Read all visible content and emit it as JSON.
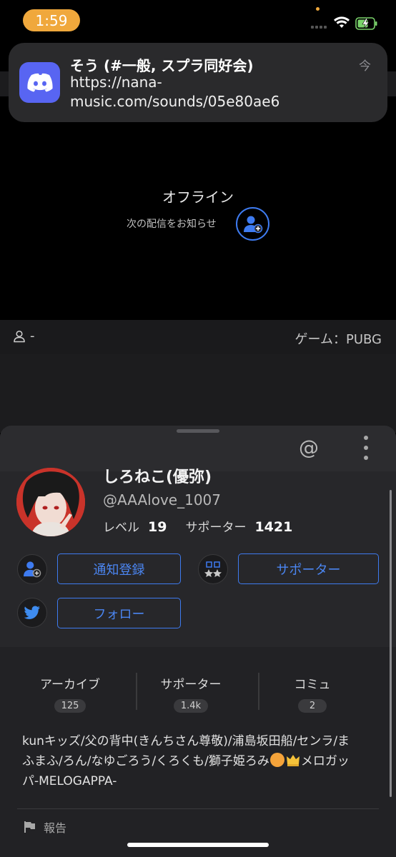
{
  "status_bar": {
    "time": "1:59"
  },
  "notification": {
    "title": "そう (#一般, スプラ同好会)",
    "body": "https://nana-music.com/sounds/05e80ae6",
    "time": "今",
    "app_icon": "discord-icon",
    "accent": "#5865f2"
  },
  "player": {
    "offline_title": "オフライン",
    "notify_text": "次の配信をお知らせ"
  },
  "info_bar": {
    "viewers": "-",
    "game": "ゲーム：PUBG"
  },
  "profile": {
    "name": "しろねこ(優弥)",
    "handle": "@AAAlove_1007",
    "level_label": "レベル",
    "level_value": "19",
    "supporter_label": "サポーター",
    "supporter_value": "1421"
  },
  "actions": {
    "notify_register": "通知登録",
    "supporter": "サポーター",
    "follow": "フォロー"
  },
  "counts": [
    {
      "label": "アーカイブ",
      "value": "125"
    },
    {
      "label": "サポーター",
      "value": "1.4k"
    },
    {
      "label": "コミュ",
      "value": "2"
    }
  ],
  "bio": {
    "line1": "kunキッズ/父の背中(きんちさん尊敬)/浦島坂田船/センラ/ま",
    "line2": "ふまふ/ろん/なゆごろう/くろくも/獅子姫ろみ",
    "line3": "メロガッ",
    "line4": "パ-MELOGAPPA-"
  },
  "report_label": "報告",
  "colors": {
    "accent_blue": "#3e7bf0",
    "time_pill": "#f0a83c",
    "background": "#000000",
    "sheet": "#222225"
  }
}
